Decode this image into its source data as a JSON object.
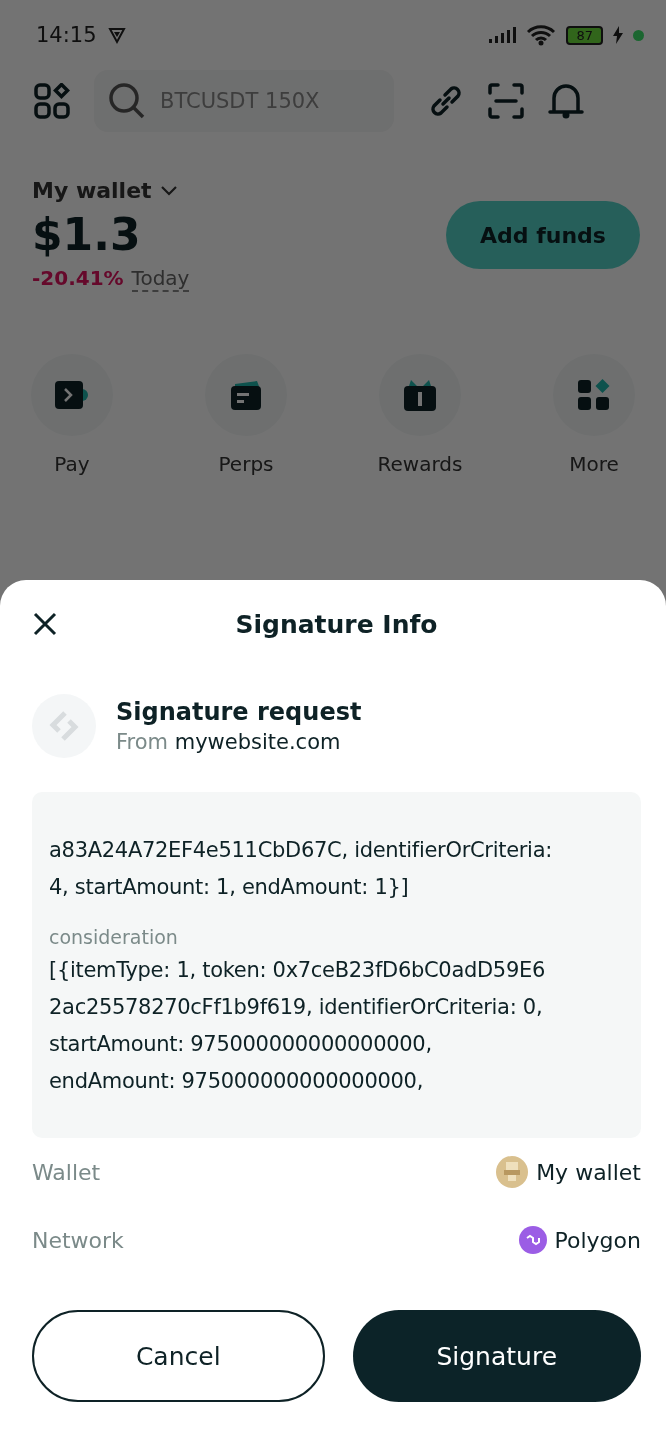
{
  "status_bar": {
    "time": "14:15",
    "battery": "87"
  },
  "header": {
    "search": {
      "placeholder": "BTCUSDT 150X"
    }
  },
  "wallet": {
    "name": "My wallet",
    "balance": "$1.3",
    "change": "-20.41%",
    "period": "Today",
    "button": "Add funds"
  },
  "shortcuts": [
    {
      "label": "Pay",
      "kind": "pay"
    },
    {
      "label": "Perps",
      "kind": "perps"
    },
    {
      "label": "Rewards",
      "kind": "rewards"
    },
    {
      "label": "More",
      "kind": "more"
    }
  ],
  "sheet": {
    "title": "Signature Info",
    "request_title": "Signature request",
    "from_label": "From",
    "from_site": "mywebsite.com",
    "message": [
      {
        "kind": "text",
        "lines": [
          "a83A24A72EF4e511CbD67C, identifierOrCriteria:",
          "4, startAmount: 1, endAmount: 1}]"
        ]
      },
      {
        "kind": "label",
        "text": "consideration"
      },
      {
        "kind": "text",
        "lines": [
          "[{itemType: 1, token: 0x7ceB23fD6bC0adD59E6",
          "2ac25578270cFf1b9f619, identifierOrCriteria: 0,",
          "startAmount: 975000000000000000,",
          "endAmount: 975000000000000000,"
        ]
      }
    ],
    "details": [
      {
        "label": "Wallet",
        "value": "My wallet",
        "kind": "wallet"
      },
      {
        "label": "Network",
        "value": "Polygon",
        "kind": "network"
      }
    ],
    "buttons": [
      {
        "label": "Cancel",
        "kind": "secondary"
      },
      {
        "label": "Signature",
        "kind": "primary"
      }
    ]
  }
}
